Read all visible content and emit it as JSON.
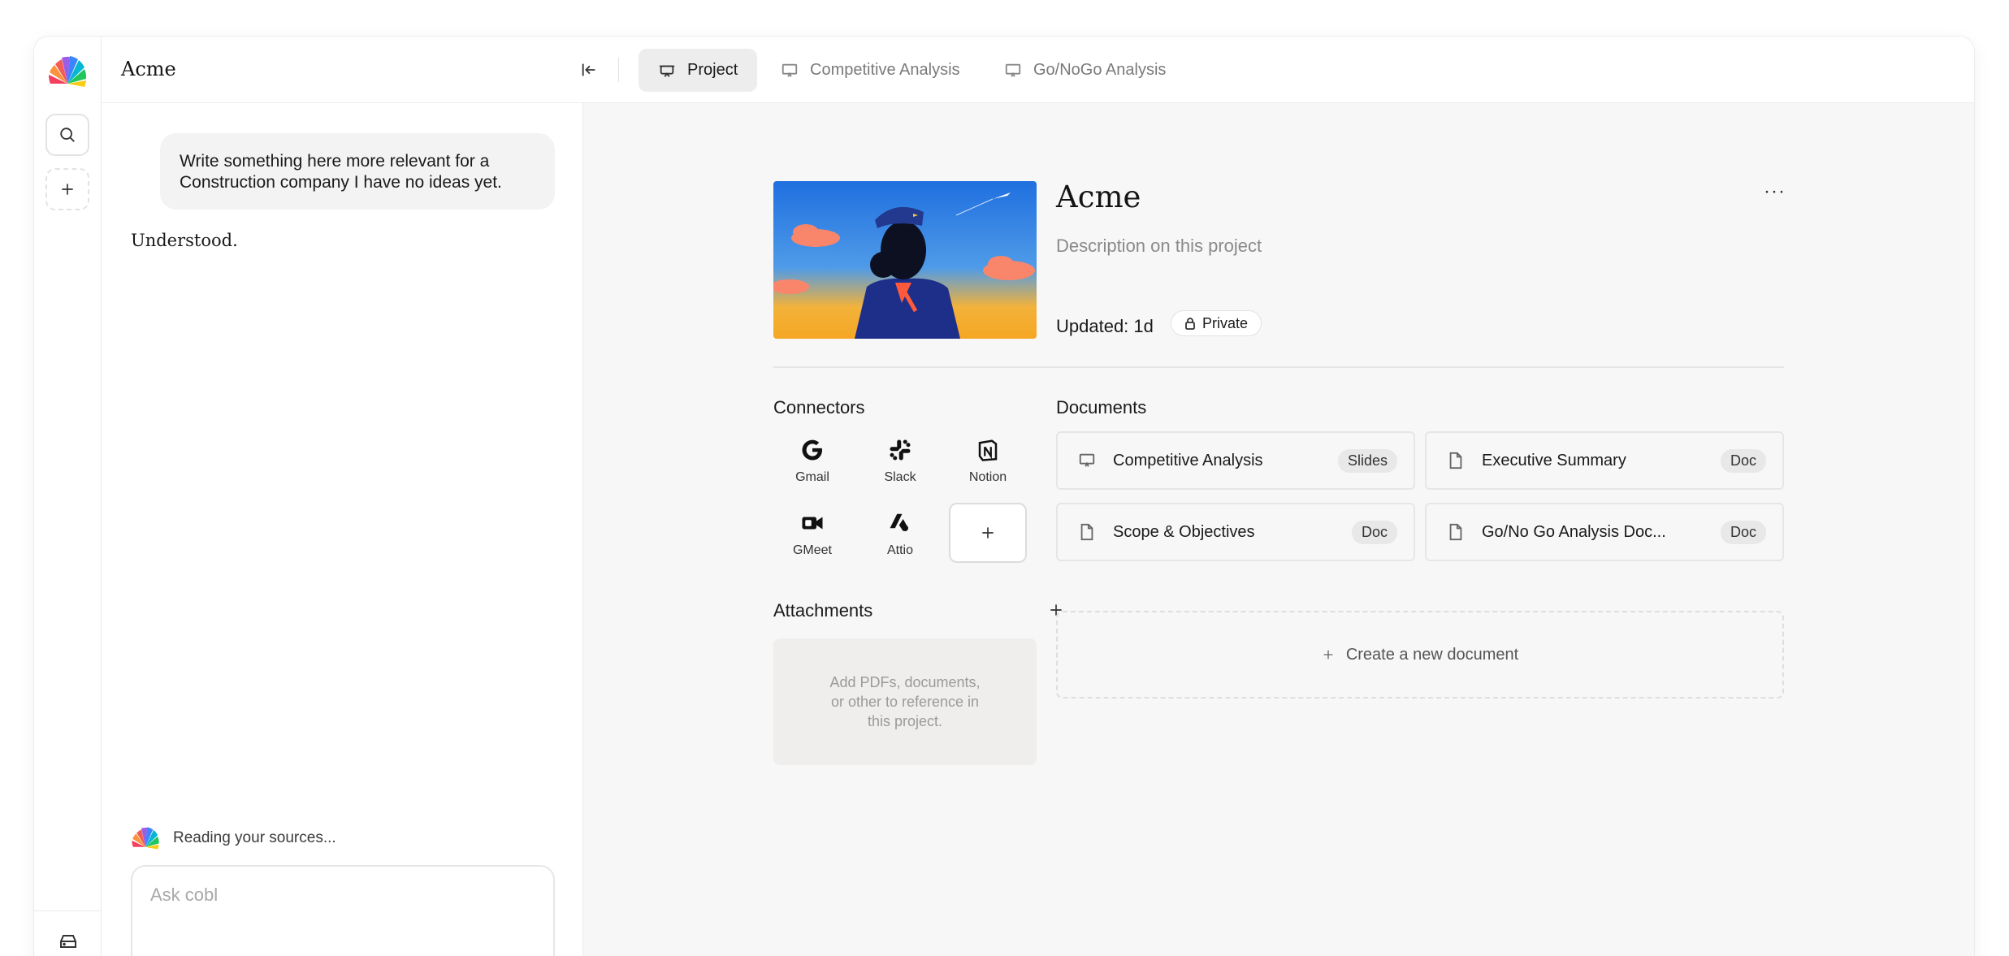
{
  "app": {
    "title": "Acme"
  },
  "tabs": [
    {
      "label": "Project",
      "icon": "presentation-icon",
      "active": true
    },
    {
      "label": "Competitive Analysis",
      "icon": "monitor-icon",
      "active": false
    },
    {
      "label": "Go/NoGo Analysis",
      "icon": "monitor-icon",
      "active": false
    }
  ],
  "chat": {
    "user_message": "Write something here more relevant for a Construction company I have no ideas yet.",
    "assistant_reply": "Understood.",
    "status": "Reading your sources...",
    "input_placeholder": "Ask cobl"
  },
  "project": {
    "title": "Acme",
    "description": "Description on this project",
    "updated": "Updated: 1d",
    "visibility": "Private"
  },
  "connectors": {
    "label": "Connectors",
    "items": [
      {
        "name": "Gmail",
        "icon": "google-icon"
      },
      {
        "name": "Slack",
        "icon": "slack-icon"
      },
      {
        "name": "Notion",
        "icon": "notion-icon"
      },
      {
        "name": "GMeet",
        "icon": "video-camera-icon"
      },
      {
        "name": "Attio",
        "icon": "attio-icon"
      }
    ]
  },
  "attachments": {
    "label": "Attachments",
    "empty_text": "Add PDFs, documents, or other to reference in this project."
  },
  "documents": {
    "label": "Documents",
    "items": [
      {
        "name": "Competitive Analysis",
        "type": "Slides",
        "icon": "monitor-icon"
      },
      {
        "name": "Executive Summary",
        "type": "Doc",
        "icon": "file-icon"
      },
      {
        "name": "Scope & Objectives",
        "type": "Doc",
        "icon": "file-icon"
      },
      {
        "name": "Go/No Go Analysis Doc...",
        "type": "Doc",
        "icon": "file-icon"
      }
    ],
    "create_label": "Create a new document"
  },
  "colors": {
    "accent_green": "#4cc35a",
    "active_tab_bg": "#ededed",
    "main_bg": "#f7f7f7"
  }
}
